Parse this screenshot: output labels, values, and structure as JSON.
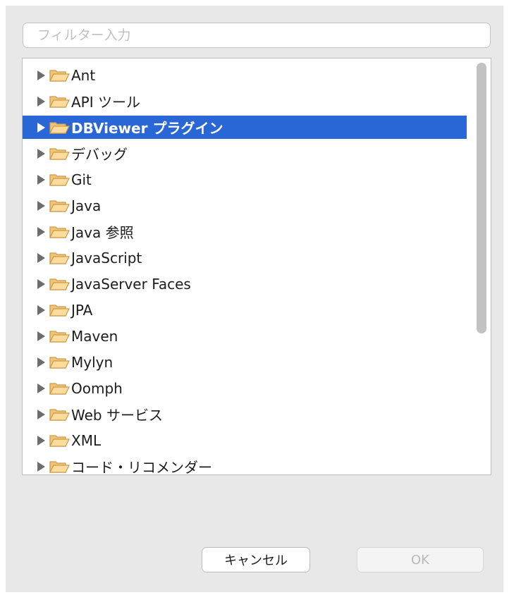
{
  "filter": {
    "placeholder": "フィルター入力",
    "value": ""
  },
  "tree": {
    "selected_index": 2,
    "items": [
      {
        "label": "Ant",
        "icon": "folder-icon"
      },
      {
        "label": "API ツール",
        "icon": "folder-icon"
      },
      {
        "label": "DBViewer プラグイン",
        "icon": "folder-icon"
      },
      {
        "label": "デバッグ",
        "icon": "folder-icon"
      },
      {
        "label": "Git",
        "icon": "folder-icon"
      },
      {
        "label": "Java",
        "icon": "folder-icon"
      },
      {
        "label": "Java 参照",
        "icon": "folder-icon"
      },
      {
        "label": "JavaScript",
        "icon": "folder-icon"
      },
      {
        "label": "JavaServer Faces",
        "icon": "folder-icon"
      },
      {
        "label": "JPA",
        "icon": "folder-icon"
      },
      {
        "label": "Maven",
        "icon": "folder-icon"
      },
      {
        "label": "Mylyn",
        "icon": "folder-icon"
      },
      {
        "label": "Oomph",
        "icon": "folder-icon"
      },
      {
        "label": "Web サービス",
        "icon": "folder-icon"
      },
      {
        "label": "XML",
        "icon": "folder-icon"
      },
      {
        "label": "コード・リコメンダー",
        "icon": "folder-icon"
      }
    ]
  },
  "buttons": {
    "cancel": "キャンセル",
    "ok": "OK",
    "ok_enabled": false
  },
  "colors": {
    "selection": "#2a67d6",
    "folder": "#f3c478",
    "folder_stroke": "#c99a48"
  }
}
